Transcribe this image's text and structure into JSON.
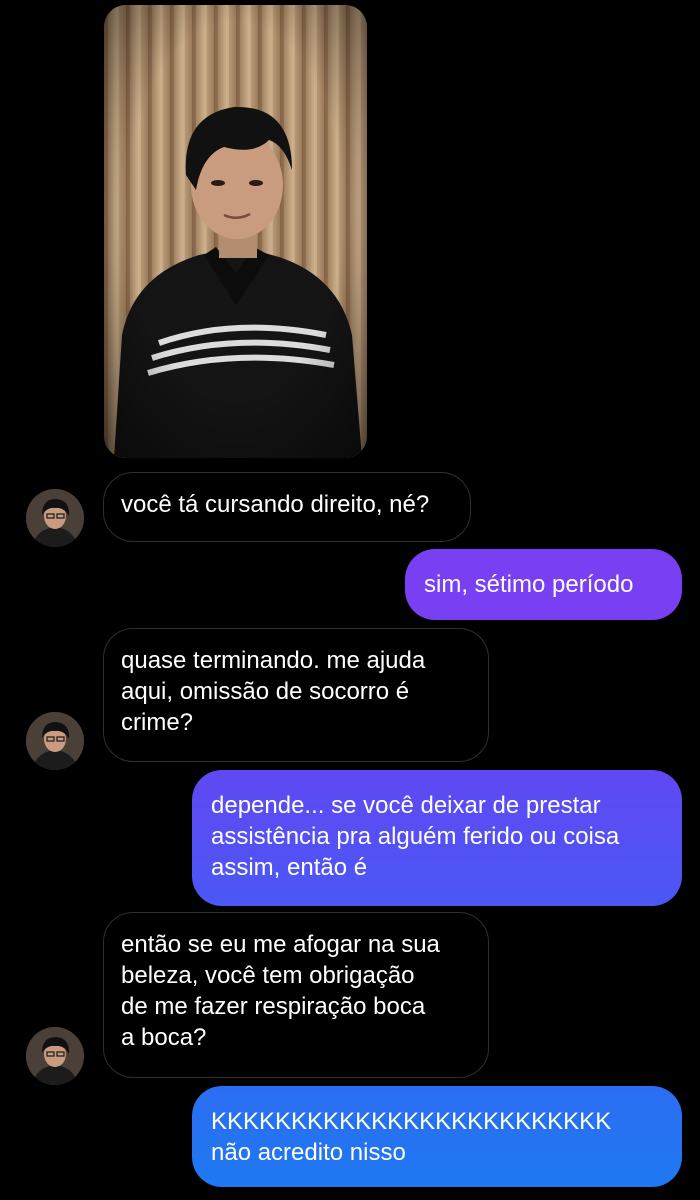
{
  "conversation": {
    "photo": {
      "description_icon": "portrait-photo"
    },
    "messages": [
      {
        "side": "received",
        "text": "você tá cursando direito, né?"
      },
      {
        "side": "sent",
        "text": "sim, sétimo período"
      },
      {
        "side": "received",
        "text": "quase terminando. me ajuda\naqui, omissão de socorro é\ncrime?"
      },
      {
        "side": "sent",
        "text": "depende... se você deixar de prestar\nassistência pra alguém ferido ou coisa\nassim, então é"
      },
      {
        "side": "received",
        "text": "então se eu me afogar na sua\nbeleza, você tem obrigação\nde me fazer respiração boca\na boca?"
      },
      {
        "side": "sent",
        "text": "KKKKKKKKKKKKKKKKKKKKKKKKK\nnão acredito nisso"
      }
    ]
  },
  "colors": {
    "background": "#000000",
    "received_border": "#2f2f2f",
    "sent_gradient_top": "#7a3df2",
    "sent_gradient_mid": "#4e58f4",
    "sent_gradient_bottom": "#1f78f2",
    "text": "#ffffff"
  }
}
